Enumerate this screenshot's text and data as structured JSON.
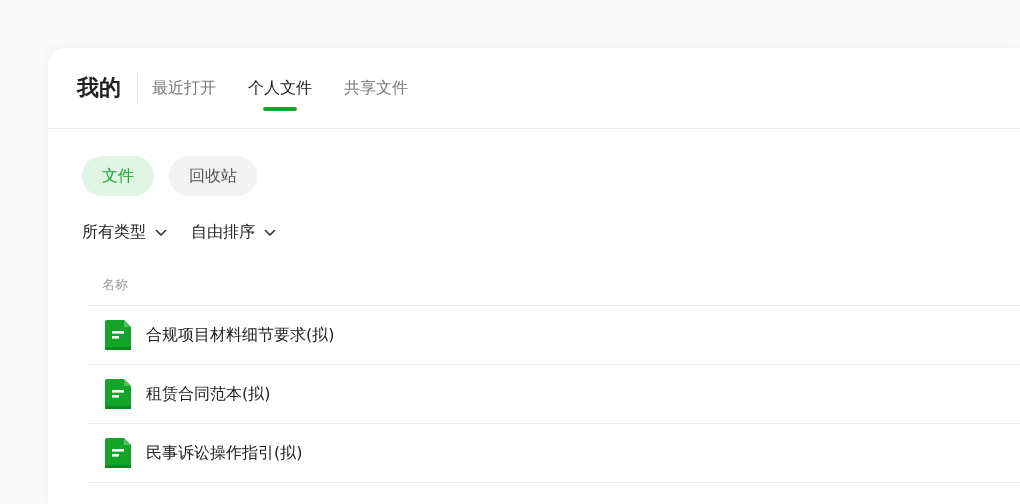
{
  "header": {
    "title": "我的"
  },
  "tabs": [
    {
      "label": "最近打开",
      "selected": false
    },
    {
      "label": "个人文件",
      "selected": true
    },
    {
      "label": "共享文件",
      "selected": false
    }
  ],
  "segments": [
    {
      "label": "文件",
      "selected": true
    },
    {
      "label": "回收站",
      "selected": false
    }
  ],
  "filters": [
    {
      "label": "所有类型"
    },
    {
      "label": "自由排序"
    }
  ],
  "table": {
    "columns": [
      "名称"
    ],
    "rows": [
      {
        "name": "合规项目材料细节要求(拟)"
      },
      {
        "name": "租赁合同范本(拟)"
      },
      {
        "name": "民事诉讼操作指引(拟)"
      }
    ]
  }
}
